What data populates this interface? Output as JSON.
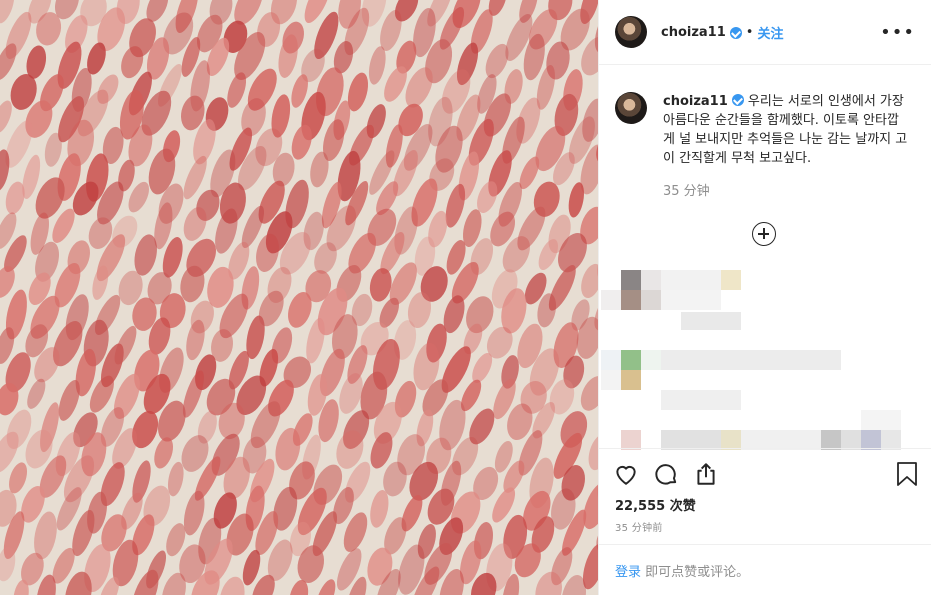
{
  "post": {
    "username": "choiza11",
    "dot": "•",
    "follow_label": "关注",
    "more_label": "•••",
    "caption": "우리는 서로의 인생에서 가장 아름다운 순간들을 함께했다. 이토록 안타깝게 널 보내지만 추억들은 나눈 감는 날까지 고이 간직할게 무척 보고싶다.",
    "caption_time": "35 分钟",
    "likes": "22,555 次赞",
    "post_time": "35 分钟前",
    "login_link": "登录",
    "login_rest": " 即可点赞或评论。"
  },
  "icons": [
    "heart-icon",
    "comment-icon",
    "share-icon",
    "bookmark-icon",
    "plus-circle-icon",
    "verified-badge-icon"
  ],
  "colors": {
    "accent": "#3897f0",
    "text": "#262626",
    "muted": "#8e8e8e",
    "border": "#efefef",
    "photo_bg": "#e7ddd2",
    "brush": "#c94a48"
  }
}
